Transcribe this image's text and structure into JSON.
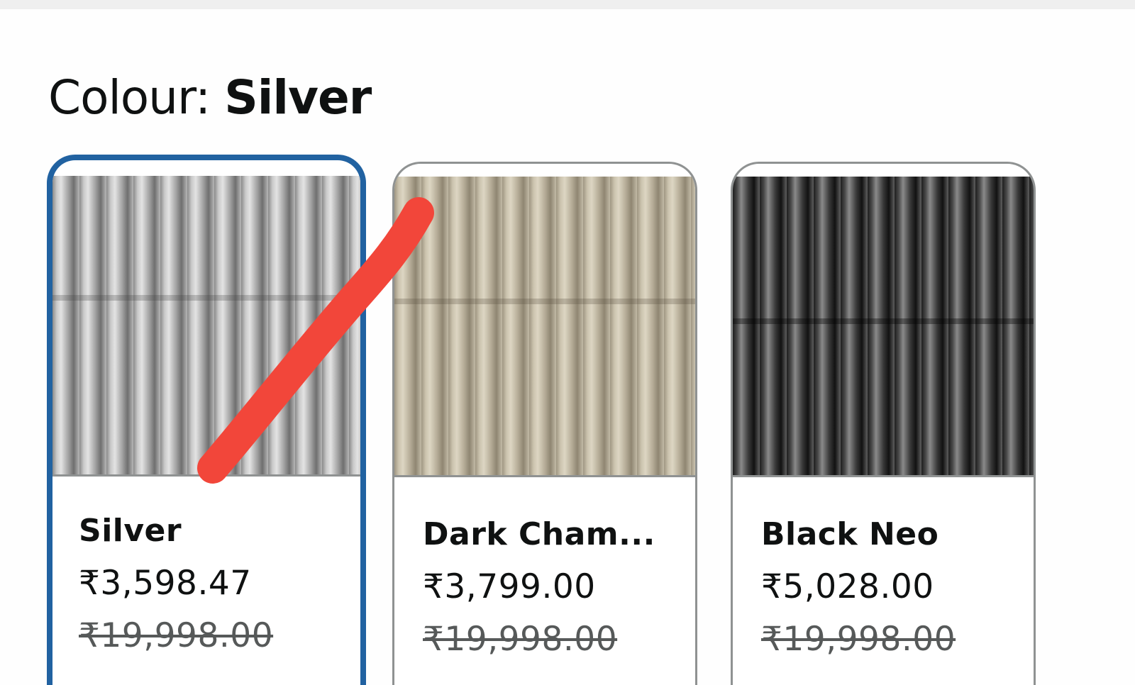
{
  "heading": {
    "label": "Colour: ",
    "selected_value": "Silver"
  },
  "swatches": [
    {
      "name": "Silver",
      "price": "₹3,598.47",
      "mrp": "₹19,998.00",
      "selected": true
    },
    {
      "name": "Dark Cham...",
      "price": "₹3,799.00",
      "mrp": "₹19,998.00",
      "selected": false
    },
    {
      "name": "Black Neo",
      "price": "₹5,028.00",
      "mrp": "₹19,998.00",
      "selected": false
    }
  ],
  "colors": {
    "selected_border": "#2162a1",
    "unselected_border": "#8f9292",
    "annotation_stroke": "#f2463a"
  }
}
